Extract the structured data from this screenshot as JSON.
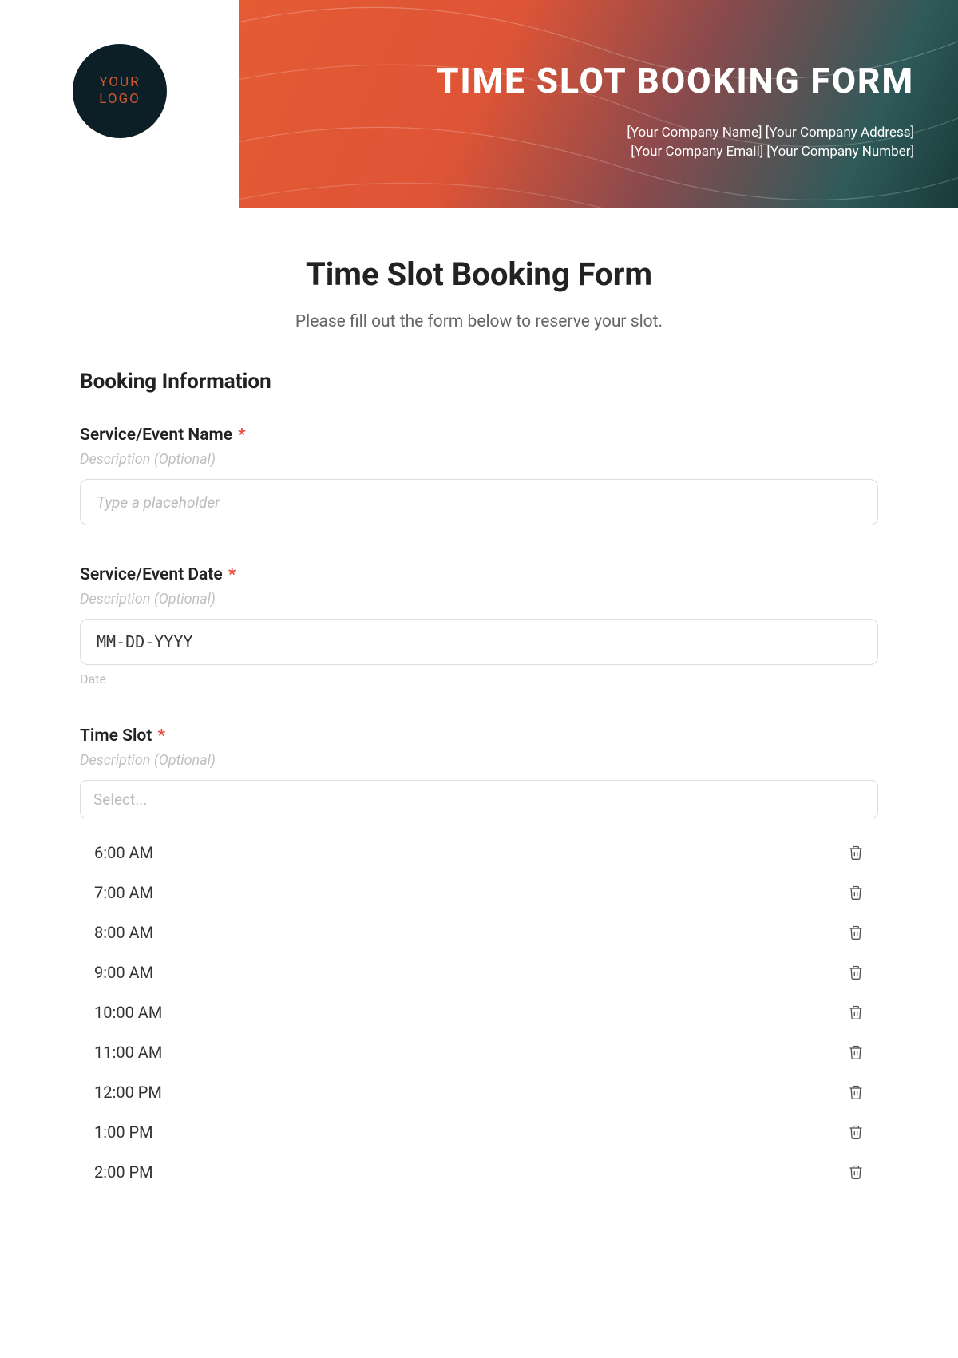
{
  "banner": {
    "logo_line1": "YOUR",
    "logo_line2": "LOGO",
    "title": "TIME SLOT BOOKING FORM",
    "meta_line1": "[Your Company Name] [Your Company Address]",
    "meta_line2": "[Your Company Email] [Your Company Number]"
  },
  "form": {
    "title": "Time Slot Booking Form",
    "subtitle": "Please fill out the form below to reserve your slot.",
    "section_heading": "Booking Information"
  },
  "fields": {
    "service_name": {
      "label": "Service/Event Name",
      "description": "Description (Optional)",
      "placeholder": "Type a placeholder"
    },
    "service_date": {
      "label": "Service/Event Date",
      "description": "Description (Optional)",
      "placeholder": "MM-DD-YYYY",
      "sublabel": "Date"
    },
    "time_slot": {
      "label": "Time Slot",
      "description": "Description (Optional)",
      "select_placeholder": "Select..."
    }
  },
  "slots": [
    {
      "label": "6:00 AM"
    },
    {
      "label": "7:00 AM"
    },
    {
      "label": "8:00 AM"
    },
    {
      "label": "9:00 AM"
    },
    {
      "label": "10:00 AM"
    },
    {
      "label": "11:00 AM"
    },
    {
      "label": "12:00 PM"
    },
    {
      "label": "1:00 PM"
    },
    {
      "label": "2:00 PM"
    }
  ],
  "required_marker": "*"
}
